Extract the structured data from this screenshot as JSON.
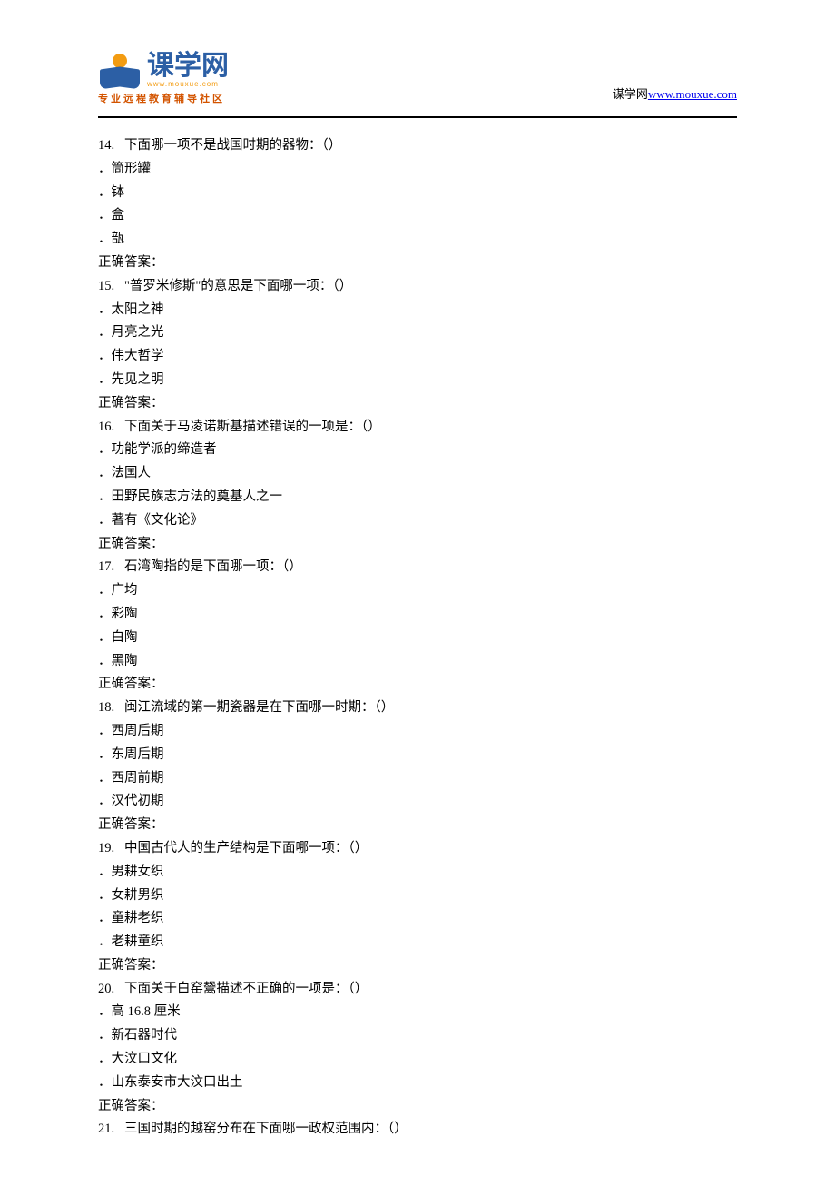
{
  "header": {
    "logo_main": "课学网",
    "logo_sub": "www.mouxue.com",
    "logo_tagline": "专业远程教育辅导社区",
    "site_label": "谋学网",
    "site_url": "www.mouxue.com"
  },
  "questions": [
    {
      "num": "14.",
      "text": "下面哪一项不是战国时期的器物：（）",
      "options": [
        "筒形罐",
        "钵",
        "盒",
        "瓿"
      ],
      "answer_label": "正确答案："
    },
    {
      "num": "15.",
      "text": "\"普罗米修斯\"的意思是下面哪一项：（）",
      "options": [
        "太阳之神",
        "月亮之光",
        "伟大哲学",
        "先见之明"
      ],
      "answer_label": "正确答案："
    },
    {
      "num": "16.",
      "text": "下面关于马凌诺斯基描述错误的一项是：（）",
      "options": [
        "功能学派的缔造者",
        "法国人",
        "田野民族志方法的奠基人之一",
        "著有《文化论》"
      ],
      "answer_label": "正确答案："
    },
    {
      "num": "17.",
      "text": "石湾陶指的是下面哪一项：（）",
      "options": [
        "广均",
        "彩陶",
        "白陶",
        "黑陶"
      ],
      "answer_label": "正确答案："
    },
    {
      "num": "18.",
      "text": "闽江流域的第一期瓷器是在下面哪一时期：（）",
      "options": [
        "西周后期",
        "东周后期",
        "西周前期",
        "汉代初期"
      ],
      "answer_label": "正确答案："
    },
    {
      "num": "19.",
      "text": "中国古代人的生产结构是下面哪一项：（）",
      "options": [
        "男耕女织",
        "女耕男织",
        "童耕老织",
        "老耕童织"
      ],
      "answer_label": "正确答案："
    },
    {
      "num": "20.",
      "text": "下面关于白窑鬶描述不正确的一项是：（）",
      "options": [
        "高 16.8 厘米",
        "新石器时代",
        "大汶口文化",
        "山东泰安市大汶口出土"
      ],
      "answer_label": "正确答案："
    },
    {
      "num": "21.",
      "text": "三国时期的越窑分布在下面哪一政权范围内：（）",
      "options": [],
      "answer_label": ""
    }
  ]
}
